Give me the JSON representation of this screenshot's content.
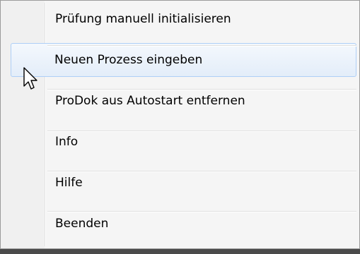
{
  "menu": {
    "items": [
      {
        "label": "Prüfung manuell initialisieren"
      },
      {
        "label": "Neuen Prozess eingeben"
      },
      {
        "label": "ProDok aus Autostart entfernen"
      },
      {
        "label": "Info"
      },
      {
        "label": "Hilfe"
      },
      {
        "label": "Beenden"
      }
    ],
    "hover_color": "#aecff7"
  },
  "cursor": {
    "icon": "arrow-cursor-icon"
  }
}
